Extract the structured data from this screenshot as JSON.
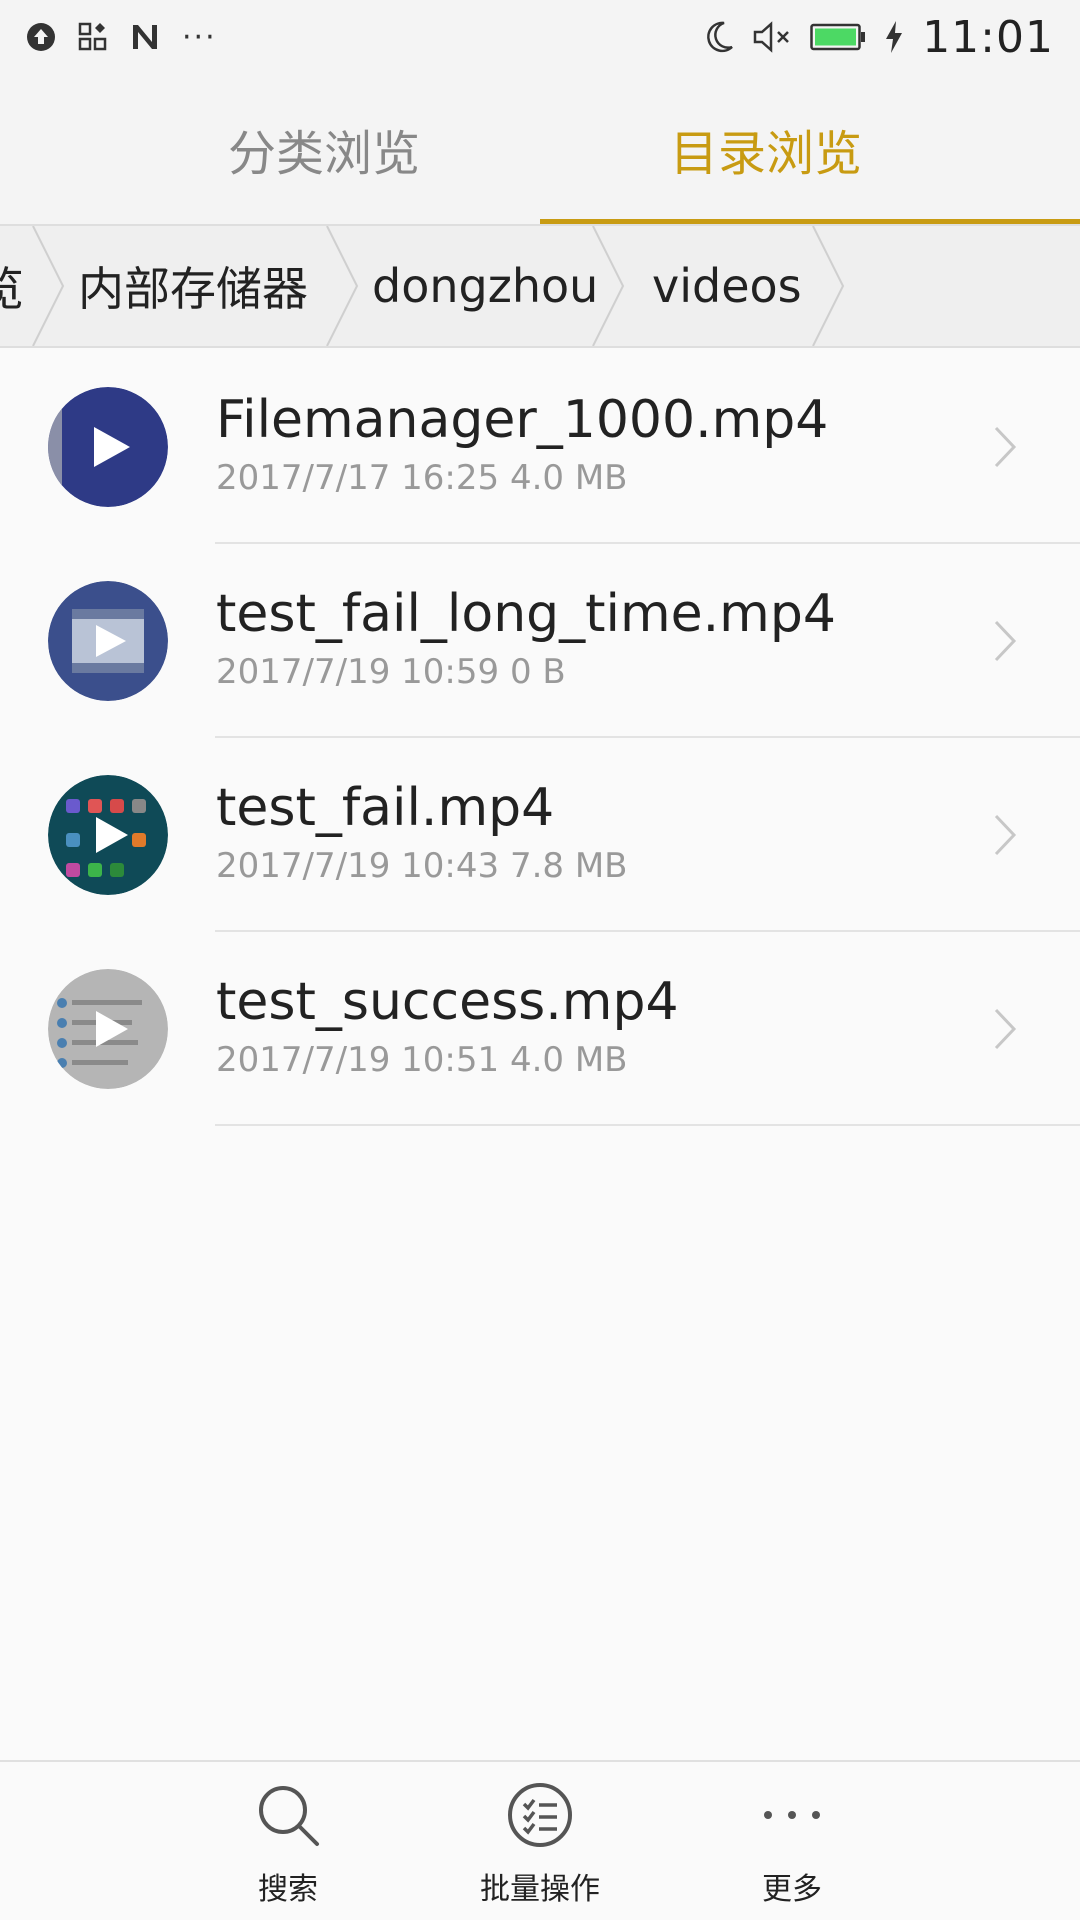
{
  "status_bar": {
    "time": "11:01",
    "more_indicator": "···",
    "icons": [
      "upload-icon",
      "apps-icon",
      "n-notification-icon",
      "moon-icon",
      "mute-icon",
      "battery-icon",
      "charging-icon"
    ],
    "battery_color": "#4cd964"
  },
  "tabs": [
    {
      "label": "分类浏览",
      "active": false
    },
    {
      "label": "目录浏览",
      "active": true
    }
  ],
  "accent_color": "#c89b12",
  "breadcrumb": {
    "items": [
      "览",
      "内部存储器",
      "dongzhou",
      "videos"
    ]
  },
  "files": [
    {
      "name": "Filemanager_1000.mp4",
      "date": "2017/7/17 16:25",
      "size": "4.0 MB",
      "thumb": "navy"
    },
    {
      "name": "test_fail_long_time.mp4",
      "date": "2017/7/19 10:59",
      "size": "0 B",
      "thumb": "film"
    },
    {
      "name": "test_fail.mp4",
      "date": "2017/7/19 10:43",
      "size": "7.8 MB",
      "thumb": "apps"
    },
    {
      "name": "test_success.mp4",
      "date": "2017/7/19 10:51",
      "size": "4.0 MB",
      "thumb": "list"
    }
  ],
  "bottom_bar": {
    "search": "搜索",
    "batch": "批量操作",
    "more": "更多"
  }
}
